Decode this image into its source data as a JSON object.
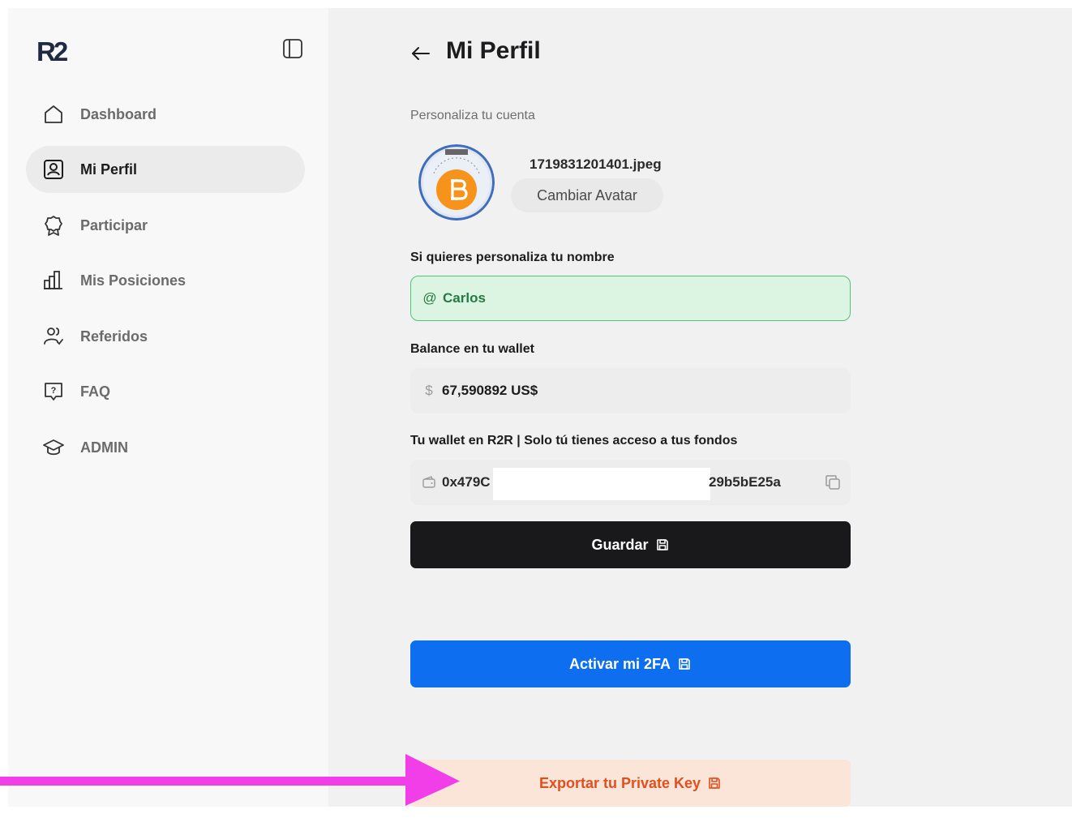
{
  "sidebar": {
    "logo_text": "R2",
    "items": [
      {
        "label": "Dashboard",
        "icon": "home-icon"
      },
      {
        "label": "Mi Perfil",
        "icon": "profile-icon",
        "active": true
      },
      {
        "label": "Participar",
        "icon": "award-icon"
      },
      {
        "label": "Mis Posiciones",
        "icon": "bar-chart-icon"
      },
      {
        "label": "Referidos",
        "icon": "users-check-icon"
      },
      {
        "label": "FAQ",
        "icon": "help-icon"
      },
      {
        "label": "ADMIN",
        "icon": "graduation-cap-icon"
      }
    ]
  },
  "header": {
    "title": "Mi Perfil"
  },
  "profile": {
    "subtitle": "Personaliza tu cuenta",
    "avatar_filename": "1719831201401.jpeg",
    "change_avatar_label": "Cambiar Avatar",
    "name_label": "Si quieres personaliza tu nombre",
    "name_prefix": "@",
    "name_value": "Carlos",
    "balance_label": "Balance en tu wallet",
    "balance_prefix": "$",
    "balance_value": "67,590892 US$",
    "wallet_label": "Tu wallet en R2R | Solo tú tienes acceso a tus fondos",
    "wallet_start": "0x479C",
    "wallet_end": "29b5bE25a"
  },
  "buttons": {
    "save": "Guardar",
    "activate_2fa": "Activar mi 2FA",
    "export_key": "Exportar tu Private Key"
  },
  "colors": {
    "active_bg": "#ebebeb",
    "name_field_bg": "#dcf5e3",
    "save_bg": "#19191b",
    "twofa_bg": "#0d6ff0",
    "export_bg": "#fbe4d8",
    "export_text": "#e24f1e",
    "annotation_arrow": "#f23ee8"
  }
}
